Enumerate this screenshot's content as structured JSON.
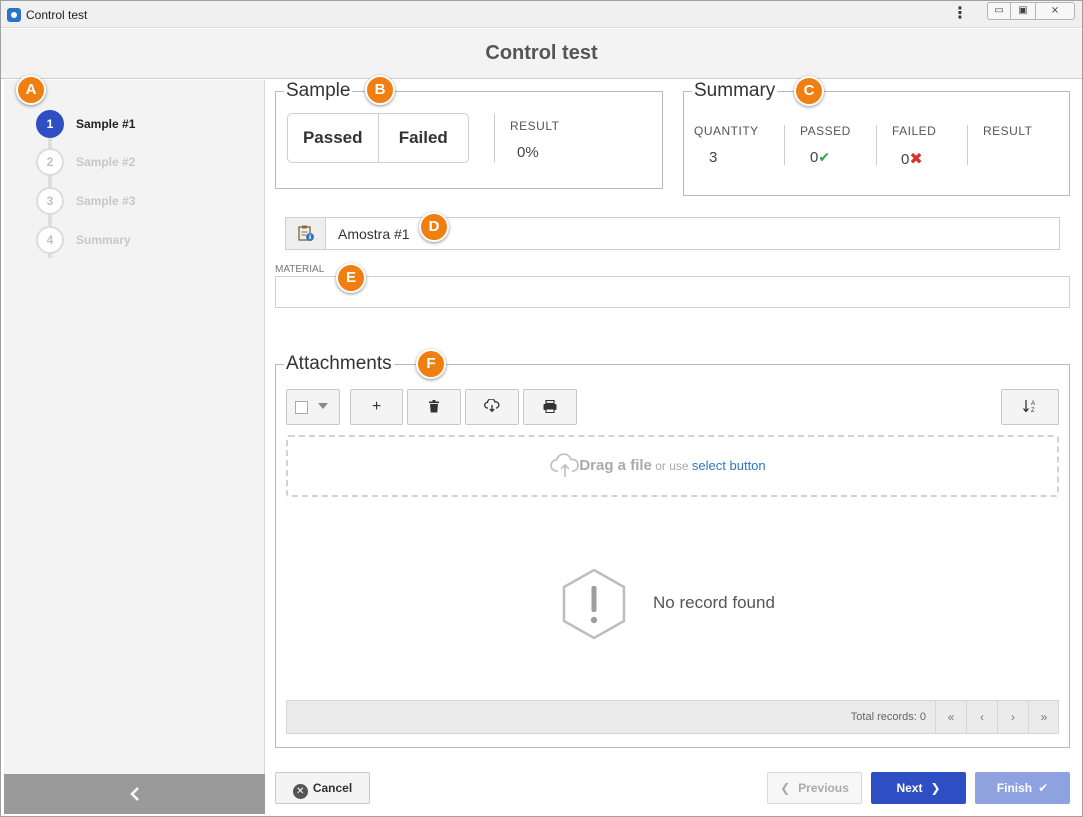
{
  "window": {
    "title": "Control test",
    "controls": {
      "minimize": "▭",
      "restore": "▣",
      "close": "⨯"
    }
  },
  "header": {
    "title": "Control test"
  },
  "sidebar": {
    "steps": [
      {
        "num": "1",
        "label": "Sample #1",
        "active": true
      },
      {
        "num": "2",
        "label": "Sample #2",
        "active": false
      },
      {
        "num": "3",
        "label": "Sample #3",
        "active": false
      },
      {
        "num": "4",
        "label": "Summary",
        "active": false
      }
    ],
    "collapse_icon": "chevron-left-icon"
  },
  "sample": {
    "legend": "Sample",
    "passed_label": "Passed",
    "failed_label": "Failed",
    "result_caption": "RESULT",
    "result_value": "0%"
  },
  "summary": {
    "legend": "Summary",
    "quantity_caption": "QUANTITY",
    "quantity_value": "3",
    "passed_caption": "PASSED",
    "passed_value": "0",
    "failed_caption": "FAILED",
    "failed_value": "0",
    "result_caption": "RESULT",
    "passed_color": "#2ea44f",
    "failed_color": "#d9342b"
  },
  "identifier": {
    "value": "Amostra #1",
    "icon": "clipboard-info-icon"
  },
  "material": {
    "label": "MATERIAL",
    "value": ""
  },
  "attachments": {
    "legend": "Attachments",
    "toolbar": {
      "add": "+",
      "delete_icon": "trash-icon",
      "download_icon": "cloud-download-icon",
      "scan_icon": "scanner-icon",
      "sort_icon": "sort-az-icon"
    },
    "dropzone": {
      "strong": "Drag a file",
      "middle": "or use",
      "link": "select button"
    },
    "empty_text": "No record found",
    "pager": {
      "total": "Total records: 0",
      "first": "«",
      "prev": "‹",
      "next": "›",
      "last": "»"
    }
  },
  "footer": {
    "cancel": "Cancel",
    "previous": "Previous",
    "next": "Next",
    "finish": "Finish"
  },
  "callouts": {
    "a": "A",
    "b": "B",
    "c": "C",
    "d": "D",
    "e": "E",
    "f": "F"
  },
  "colors": {
    "accent": "#2e4fc3",
    "finish": "#8fa2e0",
    "callout": "#f07f12",
    "link": "#2f77c6"
  }
}
